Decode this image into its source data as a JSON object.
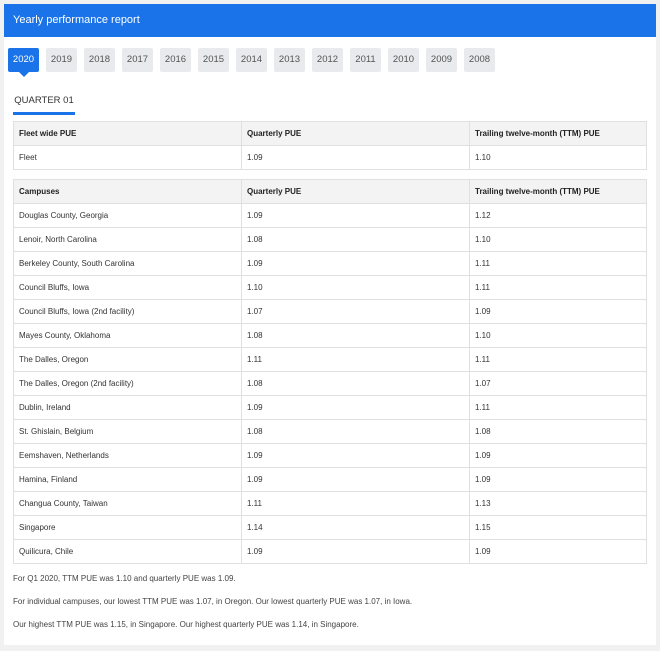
{
  "header": {
    "title": "Yearly performance report"
  },
  "years": [
    "2020",
    "2019",
    "2018",
    "2017",
    "2016",
    "2015",
    "2014",
    "2013",
    "2012",
    "2011",
    "2010",
    "2009",
    "2008"
  ],
  "selected_year": "2020",
  "quarter_tab": "QUARTER 01",
  "fleet_table": {
    "headers": [
      "Fleet wide PUE",
      "Quarterly PUE",
      "Trailing twelve-month (TTM) PUE"
    ],
    "rows": [
      [
        "Fleet",
        "1.09",
        "1.10"
      ]
    ]
  },
  "campus_table": {
    "headers": [
      "Campuses",
      "Quarterly PUE",
      "Trailing twelve-month (TTM) PUE"
    ],
    "rows": [
      [
        "Douglas County, Georgia",
        "1.09",
        "1.12"
      ],
      [
        "Lenoir, North Carolina",
        "1.08",
        "1.10"
      ],
      [
        "Berkeley County, South Carolina",
        "1.09",
        "1.11"
      ],
      [
        "Council Bluffs, Iowa",
        "1.10",
        "1.11"
      ],
      [
        "Council Bluffs, Iowa (2nd facility)",
        "1.07",
        "1.09"
      ],
      [
        "Mayes County, Oklahoma",
        "1.08",
        "1.10"
      ],
      [
        "The Dalles, Oregon",
        "1.11",
        "1.11"
      ],
      [
        "The Dalles, Oregon (2nd facility)",
        "1.08",
        "1.07"
      ],
      [
        "Dublin, Ireland",
        "1.09",
        "1.11"
      ],
      [
        "St. Ghislain, Belgium",
        "1.08",
        "1.08"
      ],
      [
        "Eemshaven, Netherlands",
        "1.09",
        "1.09"
      ],
      [
        "Hamina, Finland",
        "1.09",
        "1.09"
      ],
      [
        "Changua County, Taiwan",
        "1.11",
        "1.13"
      ],
      [
        "Singapore",
        "1.14",
        "1.15"
      ],
      [
        "Quilicura, Chile",
        "1.09",
        "1.09"
      ]
    ]
  },
  "notes": [
    "For Q1 2020, TTM PUE was 1.10 and quarterly PUE was 1.09.",
    "For individual campuses, our lowest TTM PUE was 1.07, in Oregon. Our lowest quarterly PUE was 1.07, in Iowa.",
    "Our highest TTM PUE was 1.15, in Singapore. Our highest quarterly PUE was 1.14, in Singapore."
  ]
}
